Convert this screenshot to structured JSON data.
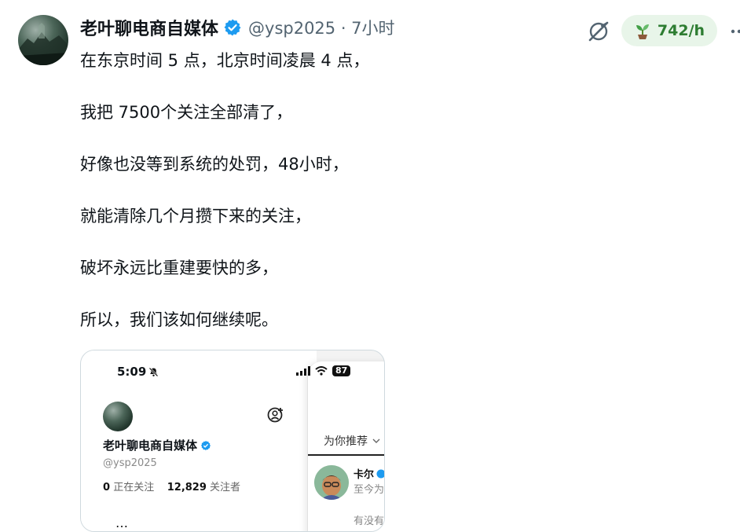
{
  "post": {
    "author_name": "老叶聊电商自媒体",
    "handle_time": "@ysp2025 · 7小时",
    "rate_label": "742/h",
    "lines": [
      "在东京时间 5 点，北京时间凌晨 4 点，",
      "我把 7500个关注全部清了，",
      "好像也没等到系统的处罚，48小时，",
      "就能清除几个月攒下来的关注，",
      "破坏永远比重建要快的多，",
      "所以，我们该如何继续呢。"
    ],
    "colors": {
      "verified": "#1d9bf0",
      "rate_bg": "#e8f5e9",
      "rate_text": "#2e7d32",
      "handle": "#536471"
    },
    "icons": {
      "grok": "grok-icon",
      "rate": "sprout-icon",
      "more": "more-icon",
      "verified": "verified-badge-icon"
    }
  },
  "screenshot": {
    "time": "5:09",
    "battery": "87",
    "profile_name": "老叶聊电商自媒体",
    "profile_handle": "@ysp2025",
    "following_count": "0",
    "following_label": "正在关注",
    "followers_count": "12,829",
    "followers_label": "关注者",
    "bottom_text": " …",
    "tab_label": "为你推荐",
    "suggest_name": "卡尔",
    "suggest_sub": "至今为",
    "suggest_sub2": "有没有"
  }
}
